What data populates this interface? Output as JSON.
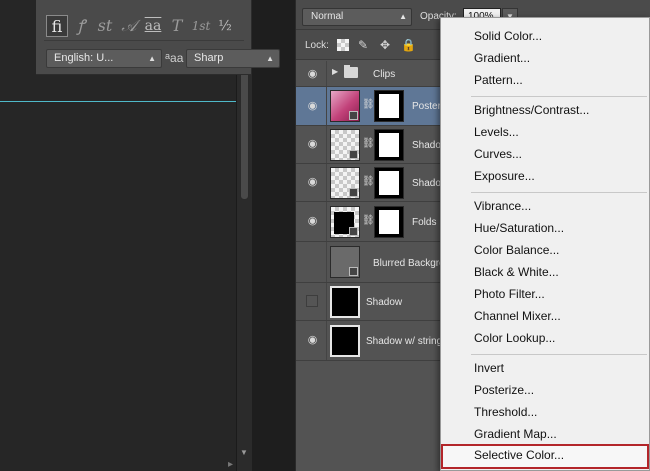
{
  "character_panel": {
    "glyphs": [
      "fi",
      "ꝭ",
      "st",
      "𝒜",
      "aa",
      "T",
      "1st",
      "½"
    ],
    "language_value": "English: U...",
    "aa_icon_label": "aa",
    "antialias_value": "Sharp"
  },
  "layers_panel": {
    "blend_mode": "Normal",
    "opacity_label": "Opacity:",
    "opacity_value": "100%",
    "lock_label": "Lock:",
    "layers": [
      {
        "name": "Clips",
        "kind": "group",
        "visible": true
      },
      {
        "name": "Poster",
        "kind": "smart",
        "visible": true,
        "selected": true
      },
      {
        "name": "Shadow",
        "kind": "masked",
        "visible": true
      },
      {
        "name": "Shadow",
        "kind": "masked",
        "visible": true
      },
      {
        "name": "Folds",
        "kind": "masked",
        "visible": true
      },
      {
        "name": "Blurred Background",
        "kind": "smart",
        "visible": true
      },
      {
        "name": "Shadow",
        "kind": "plain",
        "visible": false
      },
      {
        "name": "Shadow w/ string",
        "kind": "plain",
        "visible": true
      }
    ]
  },
  "adjustment_menu": {
    "groups": [
      [
        "Solid Color...",
        "Gradient...",
        "Pattern..."
      ],
      [
        "Brightness/Contrast...",
        "Levels...",
        "Curves...",
        "Exposure..."
      ],
      [
        "Vibrance...",
        "Hue/Saturation...",
        "Color Balance...",
        "Black & White...",
        "Photo Filter...",
        "Channel Mixer...",
        "Color Lookup..."
      ],
      [
        "Invert",
        "Posterize...",
        "Threshold...",
        "Gradient Map...",
        "Selective Color..."
      ]
    ],
    "highlighted_item": "Selective Color..."
  },
  "colors": {
    "selection_highlight": "#b3262a",
    "selected_layer": "#5f7796",
    "guide": "#4fb9c9"
  }
}
